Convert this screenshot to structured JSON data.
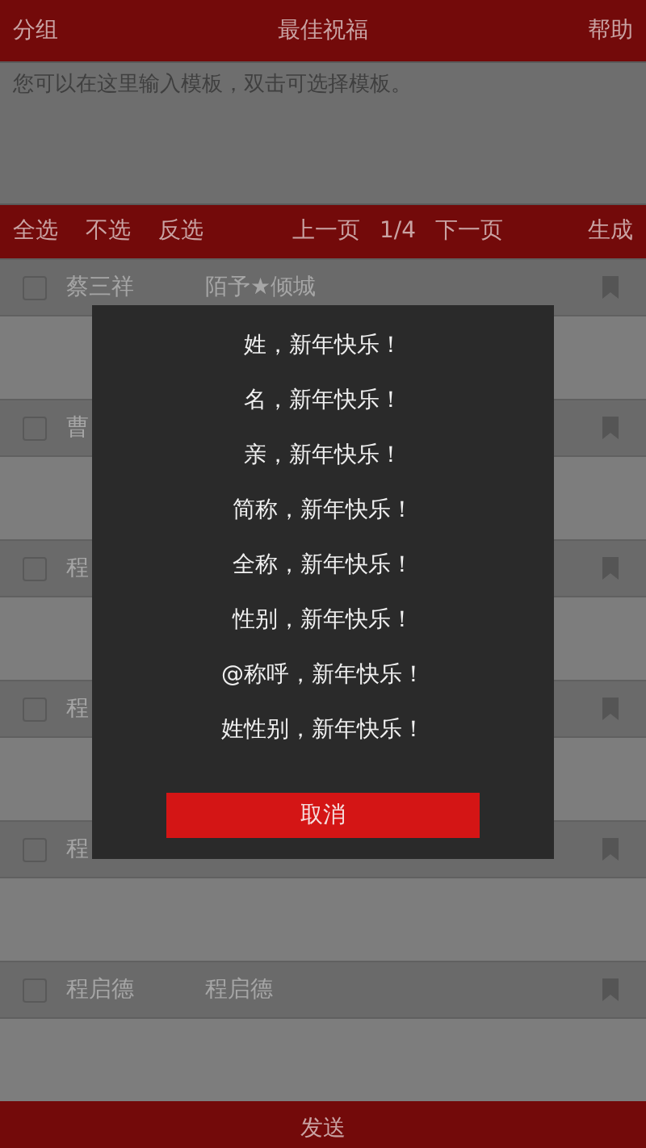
{
  "header": {
    "left": "分组",
    "title": "最佳祝福",
    "right": "帮助"
  },
  "template": {
    "placeholder": "您可以在这里输入模板，双击可选择模板。"
  },
  "toolbar": {
    "select_all": "全选",
    "select_none": "不选",
    "invert": "反选",
    "prev": "上一页",
    "page": "1/4",
    "next": "下一页",
    "generate": "生成"
  },
  "contacts": [
    {
      "name": "蔡三祥",
      "nickname": "陌予★倾城",
      "checked": false
    },
    {
      "name": "曹",
      "checked": false
    },
    {
      "name": "程",
      "checked": false
    },
    {
      "name": "程",
      "checked": false
    },
    {
      "name": "程",
      "checked": false
    },
    {
      "name": "程启德",
      "nickname": "程启德",
      "checked": false
    }
  ],
  "dialog": {
    "options": [
      "姓，新年快乐！",
      "名，新年快乐！",
      "亲，新年快乐！",
      "简称，新年快乐！",
      "全称，新年快乐！",
      "性别，新年快乐！",
      "@称呼，新年快乐！",
      "姓性别，新年快乐！"
    ],
    "cancel": "取消"
  },
  "footer": {
    "send": "发送"
  }
}
